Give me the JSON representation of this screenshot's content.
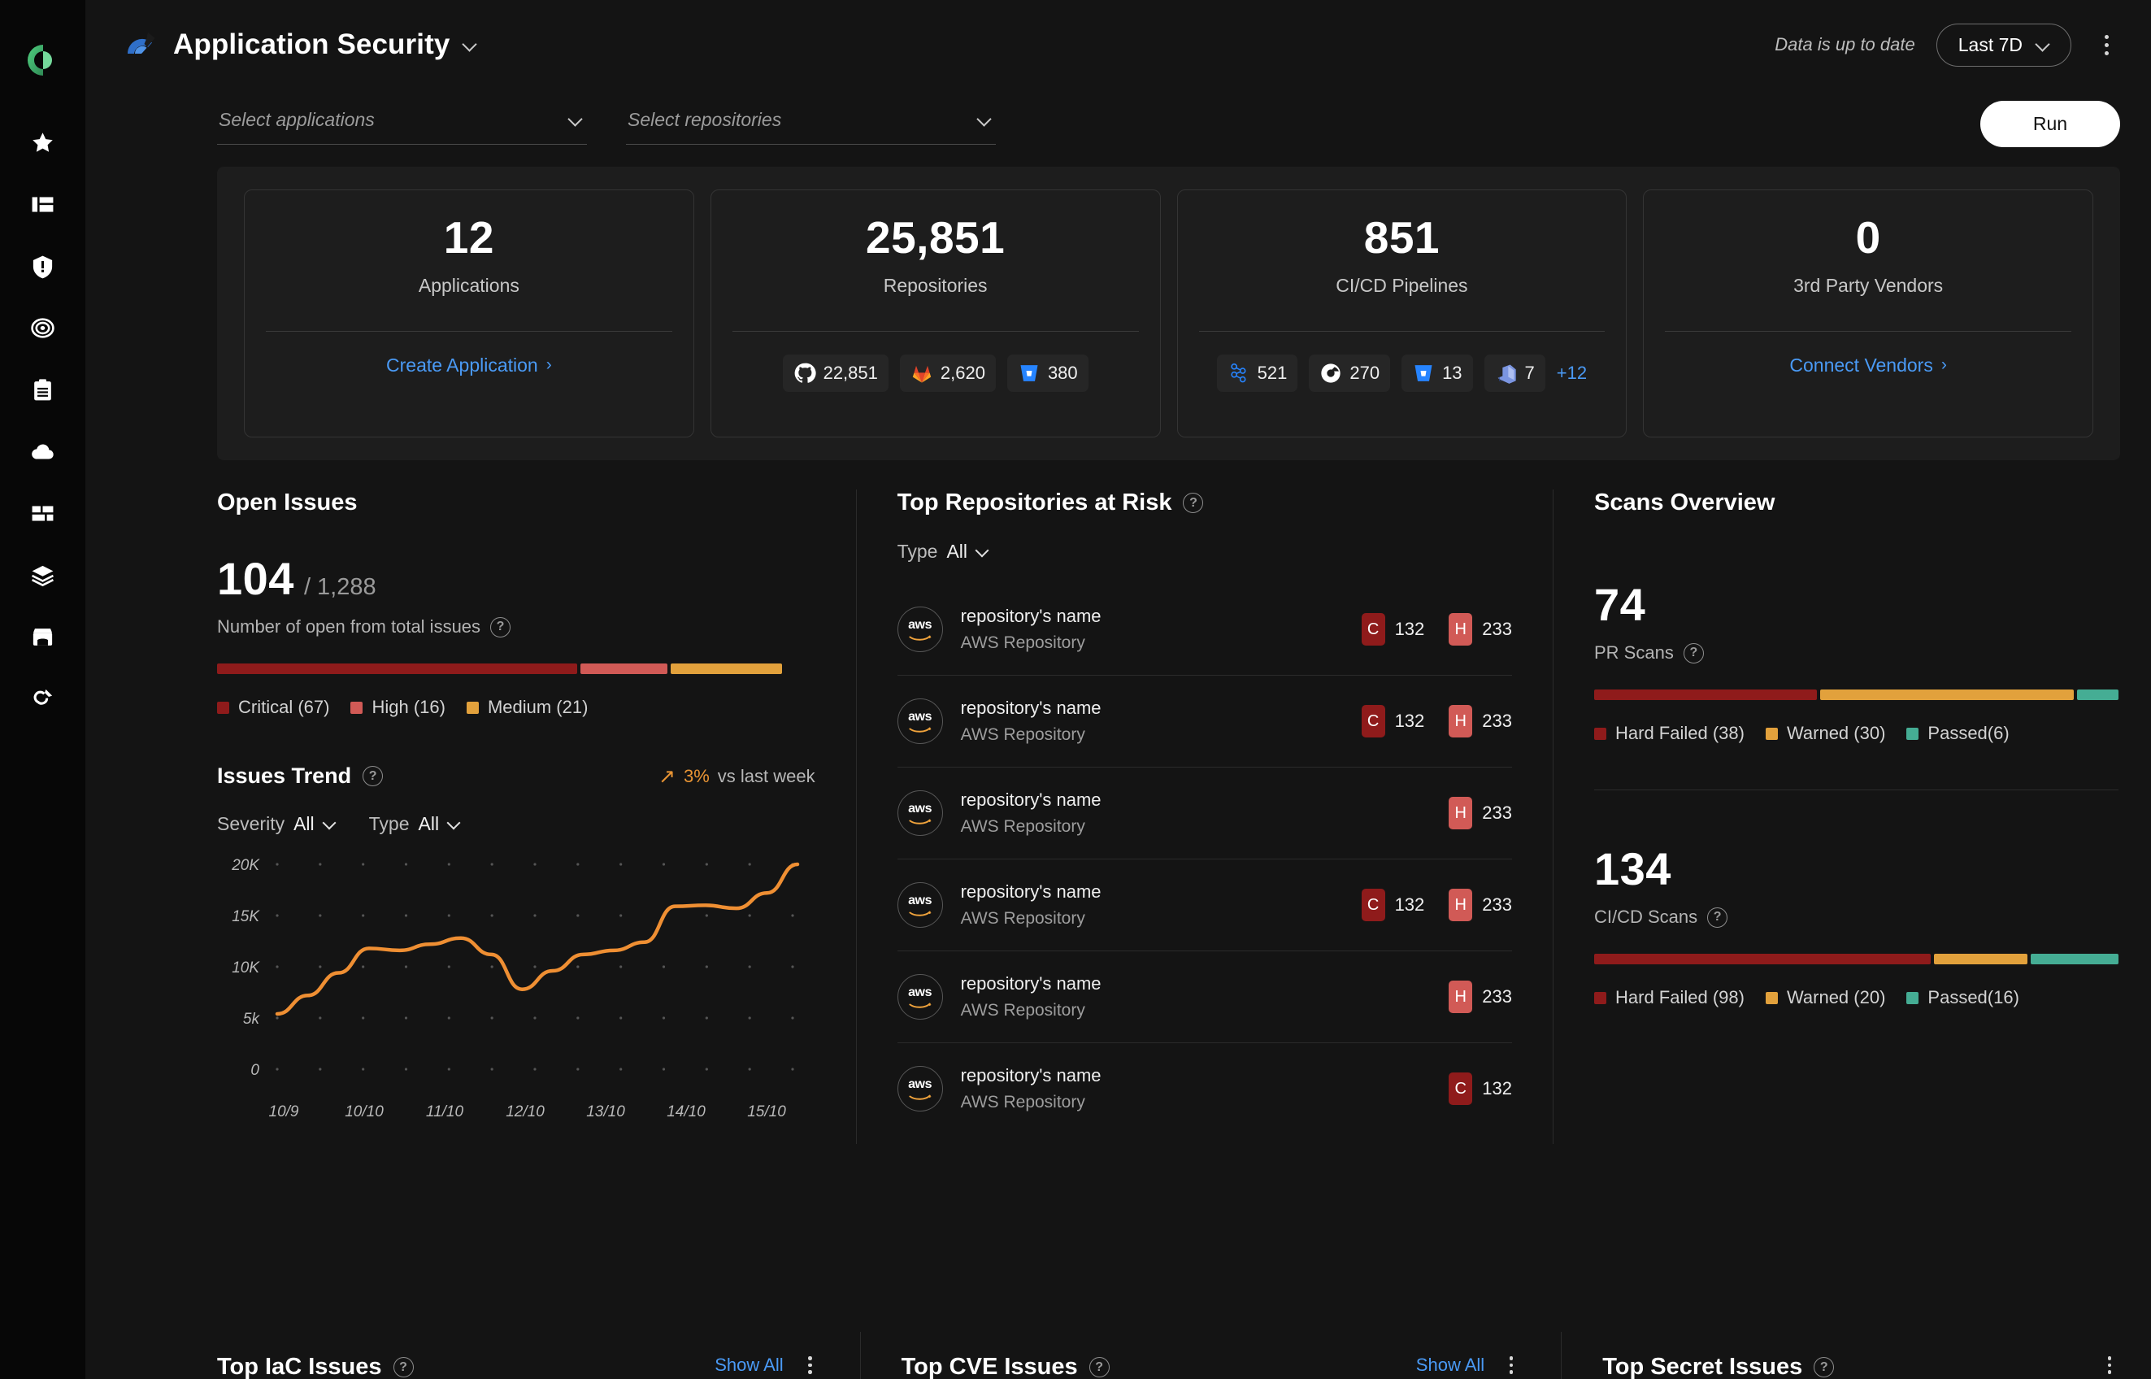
{
  "sidebar": {
    "logo_name": "cycode-logo",
    "items": [
      {
        "name": "favorites",
        "icon": "star-icon"
      },
      {
        "name": "dashboard",
        "icon": "dashboard-panels-icon"
      },
      {
        "name": "violations",
        "icon": "shield-alert-icon"
      },
      {
        "name": "policies",
        "icon": "target-icon"
      },
      {
        "name": "reports",
        "icon": "clipboard-icon"
      },
      {
        "name": "cloud",
        "icon": "cloud-icon"
      },
      {
        "name": "inventory",
        "icon": "blocks-icon"
      },
      {
        "name": "layers",
        "icon": "layers-icon"
      },
      {
        "name": "marketplace",
        "icon": "store-icon"
      },
      {
        "name": "integrations",
        "icon": "plug-icon"
      }
    ]
  },
  "header": {
    "title": "Application Security",
    "title_chevron": "chevron-down-icon",
    "data_status": "Data is up to date",
    "date_range": "Last 7D",
    "date_chevron": "chevron-down-icon",
    "more_menu": "kebab-menu-icon"
  },
  "filters": {
    "applications_placeholder": "Select applications",
    "repositories_placeholder": "Select repositories",
    "run_label": "Run"
  },
  "kpis": [
    {
      "value": "12",
      "label": "Applications",
      "link": "Create Application",
      "link_arrow": "›",
      "chips": []
    },
    {
      "value": "25,851",
      "label": "Repositories",
      "chips": [
        {
          "icon": "github-icon",
          "value": "22,851"
        },
        {
          "icon": "gitlab-icon",
          "value": "2,620"
        },
        {
          "icon": "bitbucket-icon",
          "value": "380"
        }
      ]
    },
    {
      "value": "851",
      "label": "CI/CD Pipelines",
      "chips": [
        {
          "icon": "jenkins-icon",
          "value": "521"
        },
        {
          "icon": "circleci-icon",
          "value": "270"
        },
        {
          "icon": "bitbucket-pipelines-icon",
          "value": "13"
        },
        {
          "icon": "azure-devops-icon",
          "value": "7"
        }
      ],
      "chips_more": "+12"
    },
    {
      "value": "0",
      "label": "3rd Party Vendors",
      "link": "Connect Vendors",
      "link_arrow": "›",
      "chips": []
    }
  ],
  "open_issues": {
    "title": "Open Issues",
    "open_count": "104",
    "total_count": "/ 1,288",
    "description": "Number of open from total issues",
    "help_icon": "help-circle-icon",
    "segments": [
      {
        "label": "Critical (67)",
        "value": 67,
        "color": "#8f1b1b",
        "pct": 64.5
      },
      {
        "label": "High (16)",
        "value": 16,
        "color": "#d15a56",
        "pct": 15.5
      },
      {
        "label": "Medium (21)",
        "value": 21,
        "color": "#e2a13c",
        "pct": 20.0
      }
    ]
  },
  "issues_trend": {
    "title": "Issues Trend",
    "help_icon": "help-circle-icon",
    "delta_arrow": "↗",
    "delta_value": "3%",
    "delta_text": "vs last week",
    "filters": [
      {
        "label": "Severity",
        "value": "All",
        "chevron": "chevron-down-icon"
      },
      {
        "label": "Type",
        "value": "All",
        "chevron": "chevron-down-icon"
      }
    ]
  },
  "chart_data": {
    "type": "line",
    "title": "Issues Trend",
    "x": [
      "10/9",
      "10/10",
      "11/10",
      "12/10",
      "13/10",
      "14/10",
      "15/10"
    ],
    "tick_labels_y": [
      "0",
      "5k",
      "10K",
      "15K",
      "20K"
    ],
    "ylim": [
      0,
      20000
    ],
    "series": [
      {
        "name": "Issues",
        "color": "#ef8f33",
        "values": [
          5400,
          7200,
          9400,
          11800,
          11600,
          12200,
          12800,
          11200,
          7800,
          9600,
          11200,
          11600,
          12400,
          15900,
          16000,
          15700,
          17200,
          20000
        ]
      }
    ],
    "xlabel": "",
    "ylabel": "",
    "grid": "dots",
    "legend": "none"
  },
  "top_repos": {
    "title": "Top Repositories at Risk",
    "help_icon": "help-circle-icon",
    "filter": {
      "label": "Type",
      "value": "All",
      "chevron": "chevron-down-icon"
    },
    "rows": [
      {
        "avatar": "aws-icon",
        "name": "repository's name",
        "type": "AWS Repository",
        "severities": [
          {
            "tag": "C",
            "value": "132",
            "kind": "c"
          },
          {
            "tag": "H",
            "value": "233",
            "kind": "h"
          }
        ]
      },
      {
        "avatar": "aws-icon",
        "name": "repository's name",
        "type": "AWS Repository",
        "severities": [
          {
            "tag": "C",
            "value": "132",
            "kind": "c"
          },
          {
            "tag": "H",
            "value": "233",
            "kind": "h"
          }
        ]
      },
      {
        "avatar": "aws-icon",
        "name": "repository's name",
        "type": "AWS Repository",
        "severities": [
          {
            "tag": "H",
            "value": "233",
            "kind": "h"
          }
        ]
      },
      {
        "avatar": "aws-icon",
        "name": "repository's name",
        "type": "AWS Repository",
        "severities": [
          {
            "tag": "C",
            "value": "132",
            "kind": "c"
          },
          {
            "tag": "H",
            "value": "233",
            "kind": "h"
          }
        ]
      },
      {
        "avatar": "aws-icon",
        "name": "repository's name",
        "type": "AWS Repository",
        "severities": [
          {
            "tag": "H",
            "value": "233",
            "kind": "h"
          }
        ]
      },
      {
        "avatar": "aws-icon",
        "name": "repository's name",
        "type": "AWS Repository",
        "severities": [
          {
            "tag": "C",
            "value": "132",
            "kind": "c"
          }
        ]
      }
    ]
  },
  "scans_overview": {
    "title": "Scans Overview",
    "blocks": [
      {
        "value": "74",
        "label": "PR Scans",
        "help_icon": "help-circle-icon",
        "segments": [
          {
            "label": "Hard Failed (38)",
            "value": 38,
            "color": "#8f1b1b",
            "pct": 43
          },
          {
            "label": "Warned (30)",
            "value": 30,
            "color": "#e2a13c",
            "pct": 49
          },
          {
            "label": "Passed(6)",
            "value": 6,
            "color": "#45ad94",
            "pct": 8
          }
        ]
      },
      {
        "value": "134",
        "label": "CI/CD Scans",
        "help_icon": "help-circle-icon",
        "segments": [
          {
            "label": "Hard Failed (98)",
            "value": 98,
            "color": "#8f1b1b",
            "pct": 65
          },
          {
            "label": "Warned (20)",
            "value": 20,
            "color": "#e2a13c",
            "pct": 18
          },
          {
            "label": "Passed(16)",
            "value": 16,
            "color": "#45ad94",
            "pct": 17
          }
        ]
      }
    ]
  },
  "bottom_sections": [
    {
      "title": "Top IaC Issues",
      "help_icon": "help-circle-icon",
      "show_all": "Show All",
      "menu": "kebab-menu-icon"
    },
    {
      "title": "Top CVE Issues",
      "help_icon": "help-circle-icon",
      "show_all": "Show All",
      "menu": "kebab-menu-icon"
    },
    {
      "title": "Top Secret Issues",
      "help_icon": "help-circle-icon",
      "show_all": null,
      "menu": "kebab-menu-icon"
    }
  ],
  "colors": {
    "critical": "#8f1b1b",
    "high": "#d15a56",
    "medium": "#e2a13c",
    "passed": "#45ad94",
    "accent_link": "#4a9af5",
    "trend_line": "#ef8f33"
  }
}
